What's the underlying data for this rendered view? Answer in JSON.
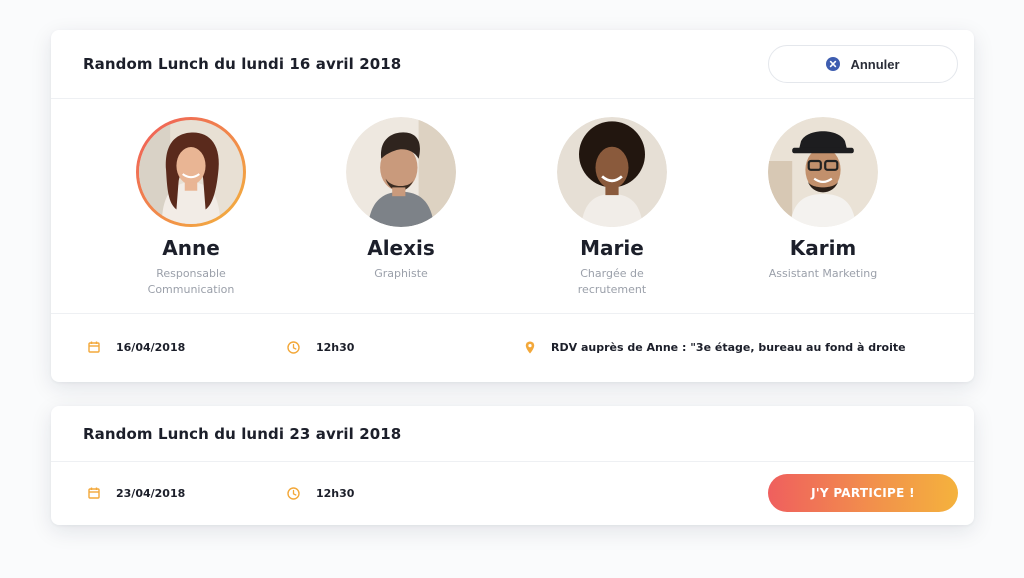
{
  "colors": {
    "accent_orange": "#f3a83a",
    "gradient_start": "#ef5f5e",
    "gradient_end": "#f4b23d",
    "cancel_icon": "#3e5db0"
  },
  "lunch1": {
    "title": "Random Lunch du lundi 16 avril 2018",
    "cancel_label": "Annuler",
    "participants": [
      {
        "name": "Anne",
        "role": "Responsable Communication",
        "selected": true,
        "icon": "avatar-photo"
      },
      {
        "name": "Alexis",
        "role": "Graphiste",
        "selected": false,
        "icon": "avatar-photo"
      },
      {
        "name": "Marie",
        "role": "Chargée de recrutement",
        "selected": false,
        "icon": "avatar-photo"
      },
      {
        "name": "Karim",
        "role": "Assistant Marketing",
        "selected": false,
        "icon": "avatar-photo"
      }
    ],
    "date": "16/04/2018",
    "time": "12h30",
    "location": "RDV auprès de Anne : \"3e étage, bureau au fond à droite"
  },
  "lunch2": {
    "title": "Random Lunch du lundi 23 avril 2018",
    "date": "23/04/2018",
    "time": "12h30",
    "join_label": "J'Y PARTICIPE !"
  }
}
